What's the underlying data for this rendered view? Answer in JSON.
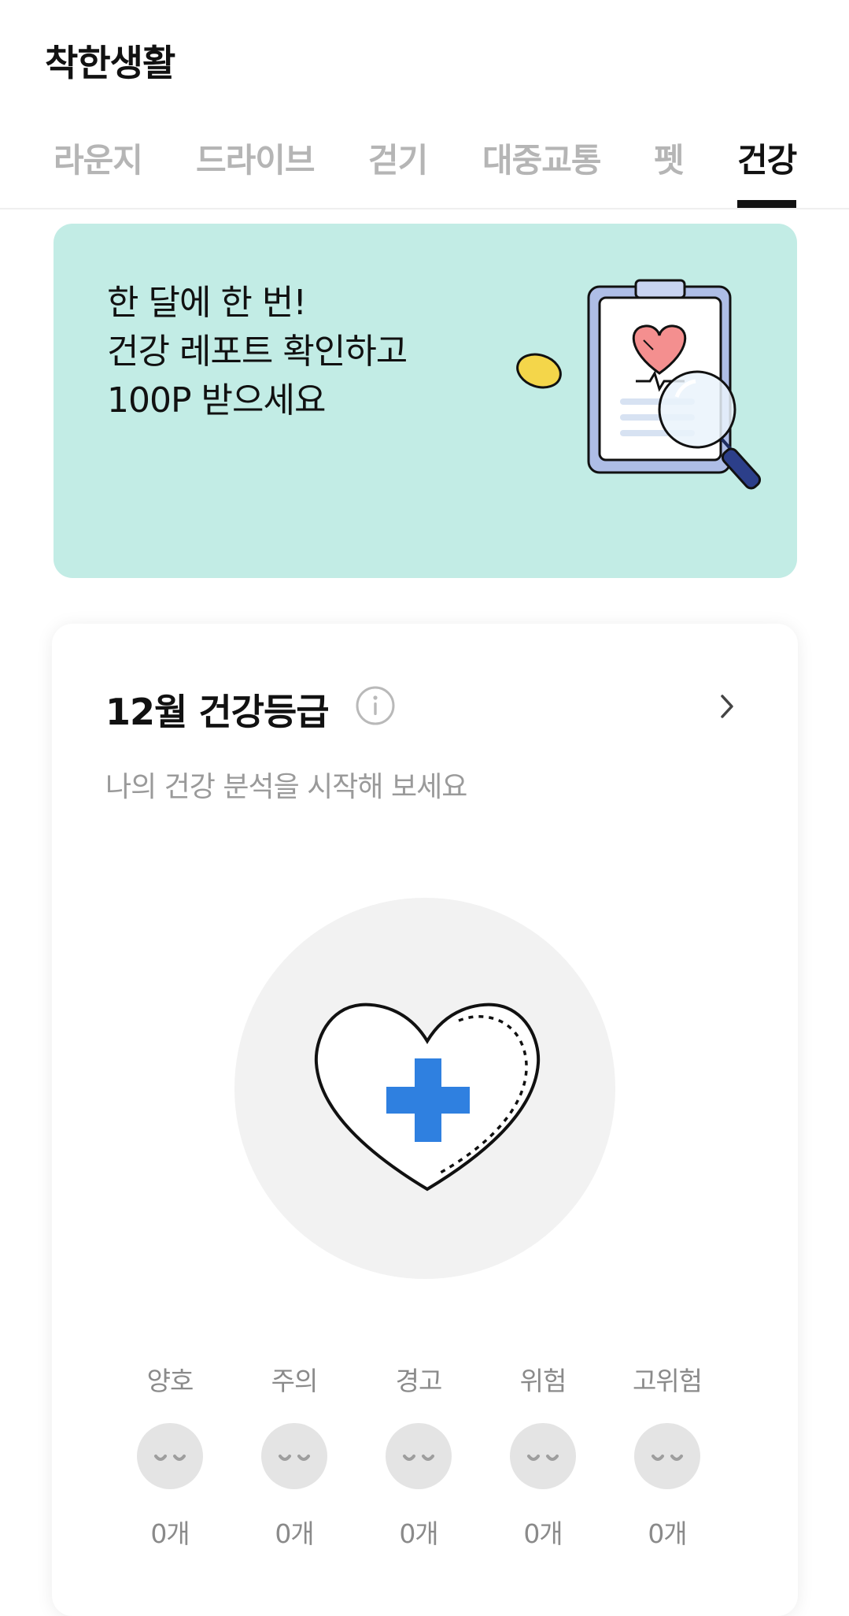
{
  "header": {
    "title": "착한생활"
  },
  "tabs": [
    {
      "label": "라운지"
    },
    {
      "label": "드라이브"
    },
    {
      "label": "걷기"
    },
    {
      "label": "대중교통"
    },
    {
      "label": "펫"
    },
    {
      "label": "건강",
      "active": true
    }
  ],
  "banner": {
    "lines": [
      "한 달에 한 번!",
      "건강 레포트 확인하고",
      "100P 받으세요"
    ],
    "background": "#c2ece5",
    "icon": "clipboard-heart-magnifier-illustration"
  },
  "health_card": {
    "title": "12월 건강등급",
    "subtitle": "나의 건강 분석을 시작해 보세요",
    "info_icon": "info-icon",
    "chevron_icon": "chevron-right-icon",
    "center_icon": "heart-plus-icon",
    "accent": "#2f80e0",
    "levels": [
      {
        "label": "양호",
        "count": "0개"
      },
      {
        "label": "주의",
        "count": "0개"
      },
      {
        "label": "경고",
        "count": "0개"
      },
      {
        "label": "위험",
        "count": "0개"
      },
      {
        "label": "고위험",
        "count": "0개"
      }
    ]
  }
}
